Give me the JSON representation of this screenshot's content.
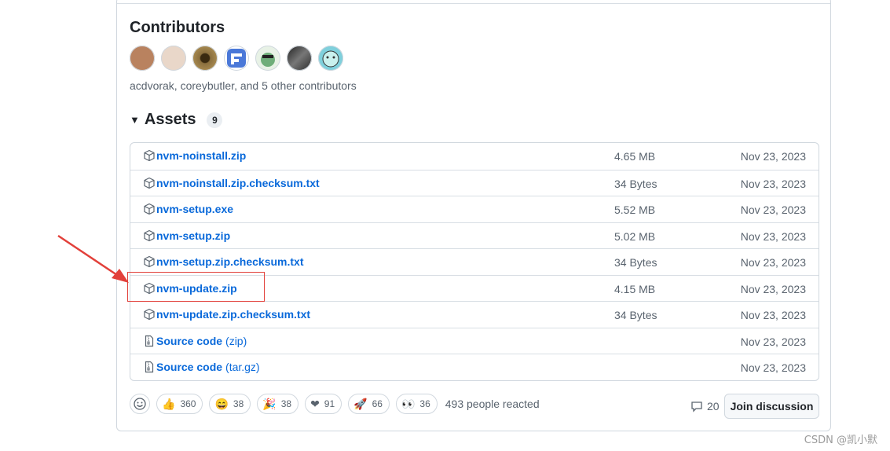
{
  "contributors": {
    "heading": "Contributors",
    "text": "acdvorak, coreybutler, and 5 other contributors",
    "avatars": [
      {
        "name": "avatar-1",
        "color": "#b9825f"
      },
      {
        "name": "avatar-2",
        "color": "#e9d7c9"
      },
      {
        "name": "avatar-3",
        "color": "#8a6f3e"
      },
      {
        "name": "avatar-4",
        "color": "#4a78d8"
      },
      {
        "name": "avatar-5",
        "color": "#6fae7a"
      },
      {
        "name": "avatar-6",
        "color": "#4a4a4a"
      },
      {
        "name": "avatar-7",
        "color": "#7fd0dc"
      }
    ]
  },
  "assets": {
    "heading": "Assets",
    "count": "9",
    "rows": [
      {
        "name": "nvm-noinstall.zip",
        "suffix": "",
        "size": "4.65 MB",
        "date": "Nov 23, 2023",
        "icon": "package-icon"
      },
      {
        "name": "nvm-noinstall.zip.checksum.txt",
        "suffix": "",
        "size": "34 Bytes",
        "date": "Nov 23, 2023",
        "icon": "package-icon"
      },
      {
        "name": "nvm-setup.exe",
        "suffix": "",
        "size": "5.52 MB",
        "date": "Nov 23, 2023",
        "icon": "package-icon"
      },
      {
        "name": "nvm-setup.zip",
        "suffix": "",
        "size": "5.02 MB",
        "date": "Nov 23, 2023",
        "icon": "package-icon"
      },
      {
        "name": "nvm-setup.zip.checksum.txt",
        "suffix": "",
        "size": "34 Bytes",
        "date": "Nov 23, 2023",
        "icon": "package-icon"
      },
      {
        "name": "nvm-update.zip",
        "suffix": "",
        "size": "4.15 MB",
        "date": "Nov 23, 2023",
        "icon": "package-icon"
      },
      {
        "name": "nvm-update.zip.checksum.txt",
        "suffix": "",
        "size": "34 Bytes",
        "date": "Nov 23, 2023",
        "icon": "package-icon"
      },
      {
        "name": "Source code",
        "suffix": "(zip)",
        "size": "",
        "date": "Nov 23, 2023",
        "icon": "file-zip-icon"
      },
      {
        "name": "Source code",
        "suffix": "(tar.gz)",
        "size": "",
        "date": "Nov 23, 2023",
        "icon": "file-zip-icon"
      }
    ]
  },
  "reactions": {
    "items": [
      {
        "emoji": "👍",
        "count": "360",
        "name": "thumbs-up"
      },
      {
        "emoji": "😄",
        "count": "38",
        "name": "laugh"
      },
      {
        "emoji": "🎉",
        "count": "38",
        "name": "hooray"
      },
      {
        "emoji": "❤",
        "count": "91",
        "name": "heart"
      },
      {
        "emoji": "🚀",
        "count": "66",
        "name": "rocket"
      },
      {
        "emoji": "👀",
        "count": "36",
        "name": "eyes"
      }
    ],
    "summary": "493 people reacted",
    "comments": "20",
    "join_label": "Join discussion"
  },
  "watermark": "CSDN @凯小默",
  "colors": {
    "link": "#0969da",
    "highlight": "#e2403a",
    "muted": "#59636e"
  }
}
